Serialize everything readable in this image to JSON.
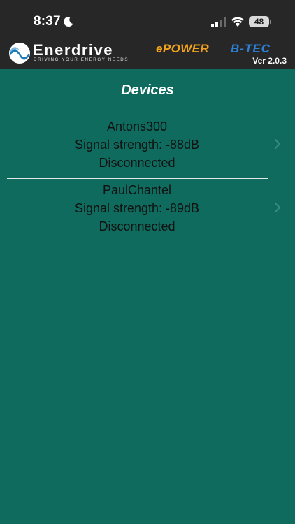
{
  "status_bar": {
    "time": "8:37",
    "battery_level": "48",
    "icons": [
      "moon-icon",
      "cellular-signal-icon",
      "wifi-icon",
      "battery-icon"
    ]
  },
  "header": {
    "brand_name": "Enerdrive",
    "brand_tagline": "DRIVING YOUR ENERGY NEEDS",
    "product_epower": "ePOWER",
    "product_btec": "B-TEC",
    "version": "Ver 2.0.3"
  },
  "main": {
    "title": "Devices",
    "devices": [
      {
        "name": "Antons300",
        "signal": "Signal strength: -88dB",
        "status": "Disconnected"
      },
      {
        "name": "PaulChantel",
        "signal": "Signal strength: -89dB",
        "status": "Disconnected"
      }
    ]
  },
  "colors": {
    "background": "#0e6b5e",
    "header_bar": "#272727",
    "epower_orange": "#f2a21b",
    "btec_blue": "#2e7fd6"
  }
}
